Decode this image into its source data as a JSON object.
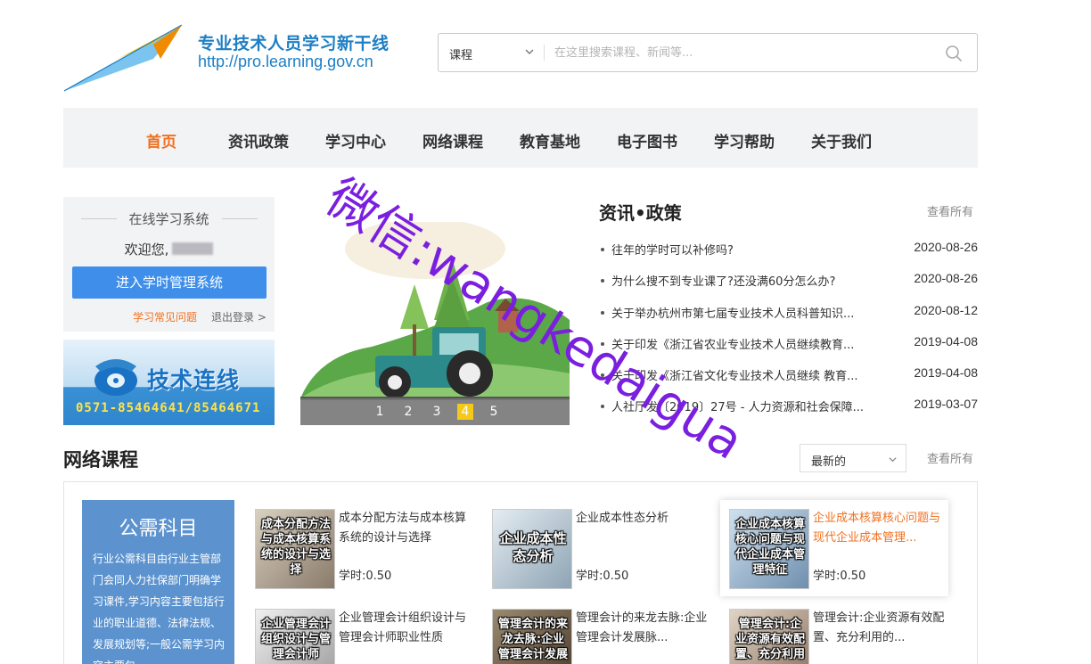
{
  "header": {
    "logo_title": "专业技术人员学习新干线",
    "logo_url": "http://pro.learning.gov.cn",
    "search_category": "课程",
    "search_placeholder": "在这里搜索课程、新闻等..."
  },
  "nav": {
    "items": [
      "首页",
      "资讯政策",
      "学习中心",
      "网络课程",
      "教育基地",
      "电子图书",
      "学习帮助",
      "关于我们"
    ],
    "active": "首页"
  },
  "login_panel": {
    "title": "在线学习系统",
    "welcome": "欢迎您,",
    "enter_button": "进入学时管理系统",
    "faq_link": "学习常见问题",
    "logout_link": "退出登录 >"
  },
  "hotline": {
    "title": "技术连线",
    "phone": "0571-85464641/85464671"
  },
  "carousel": {
    "pages": [
      "1",
      "2",
      "3",
      "4",
      "5"
    ],
    "active_page": "4"
  },
  "news": {
    "title": "资讯•政策",
    "more": "查看所有",
    "items": [
      {
        "text": "往年的学时可以补修吗?",
        "date": "2020-08-26"
      },
      {
        "text": "为什么搜不到专业课了?还没满60分怎么办?",
        "date": "2020-08-26"
      },
      {
        "text": "关于举办杭州市第七届专业技术人员科普知识...",
        "date": "2020-08-12"
      },
      {
        "text": "关于印发《浙江省农业专业技术人员继续教育...",
        "date": "2019-04-08"
      },
      {
        "text": "关于印发《浙江省文化专业技术人员继续 教育...",
        "date": "2019-04-08"
      },
      {
        "text": "人社厅发〔2019〕27号 - 人力资源和社会保障...",
        "date": "2019-03-07"
      }
    ]
  },
  "courses": {
    "title": "网络课程",
    "sort_value": "最新的",
    "more": "查看所有",
    "category": {
      "title": "公需科目",
      "description": "行业公需科目由行业主管部门会同人力社保部门明确学习课件,学习内容主要包括行业的职业道德、法律法规、发展规划等;一般公需学习内容主要包"
    },
    "items": [
      {
        "thumb": "成本分配方法与成本核算系统的设计与选择",
        "name": "成本分配方法与成本核算系统的设计与选择",
        "hours": "学时:0.50"
      },
      {
        "thumb": "企业成本性态分析",
        "name": "企业成本性态分析",
        "hours": "学时:0.50"
      },
      {
        "thumb": "企业成本核算核心问题与现代企业成本管理特征",
        "name": "企业成本核算核心问题与现代企业成本管理...",
        "hours": "学时:0.50"
      },
      {
        "thumb": "企业管理会计组织设计与管理会计师",
        "name": "企业管理会计组织设计与管理会计师职业性质",
        "hours": ""
      },
      {
        "thumb": "管理会计的来龙去脉:企业管理会计发展",
        "name": "管理会计的来龙去脉:企业管理会计发展脉...",
        "hours": ""
      },
      {
        "thumb": "管理会计:企业资源有效配置、充分利用",
        "name": "管理会计:企业资源有效配置、充分利用的...",
        "hours": ""
      }
    ]
  },
  "watermark": "微信:wangkedaigua",
  "colors": {
    "brand_blue": "#1d7fc4",
    "accent_orange": "#f07020",
    "button_blue": "#3e8eea",
    "nav_bg": "#f2f3f5",
    "watermark_purple": "#7a1fe0"
  }
}
